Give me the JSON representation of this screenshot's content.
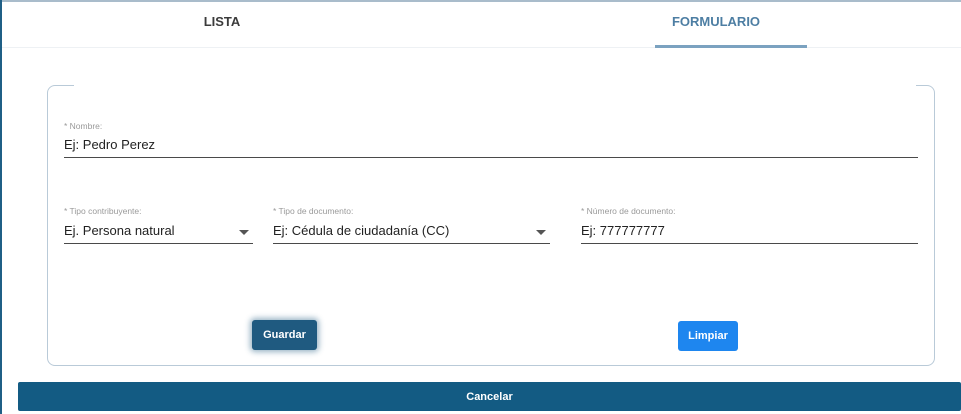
{
  "tabs": [
    {
      "label": "LISTA",
      "active": false
    },
    {
      "label": "FORMULARIO",
      "active": true
    }
  ],
  "form": {
    "nombre": {
      "label": "* Nombre:",
      "placeholder": "Ej: Pedro Perez"
    },
    "tipo_contribuyente": {
      "label": "* Tipo contribuyente:",
      "value": "Ej. Persona natural",
      "icon": "chevron-down-icon"
    },
    "tipo_documento": {
      "label": "* Tipo de documento:",
      "value": "Ej: Cédula de ciudadanía (CC)",
      "icon": "chevron-down-icon"
    },
    "numero_documento": {
      "label": "* Número de documento:",
      "placeholder": "Ej: 777777777"
    }
  },
  "buttons": {
    "guardar": "Guardar",
    "limpiar": "Limpiar",
    "cancelar": "Cancelar"
  },
  "colors": {
    "active_tab": "#4d7ea3",
    "guardar": "#1f5a80",
    "limpiar": "#1e86ef",
    "cancelar": "#135b83"
  }
}
